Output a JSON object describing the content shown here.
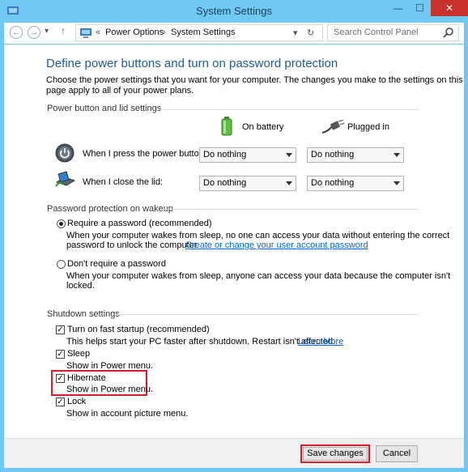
{
  "window": {
    "title": "System Settings",
    "minimize": "—",
    "maximize": "☐",
    "close": "✕"
  },
  "nav": {
    "back": "←",
    "forward": "→",
    "dropdown": "▾",
    "up": "↑",
    "refresh": "↻",
    "crumb_sep": "«",
    "breadcrumb": [
      "Power Options",
      "System Settings"
    ],
    "breadcrumb_arrow": "›",
    "address_dropdown": "▾",
    "search_placeholder": "Search Control Panel"
  },
  "main": {
    "heading": "Define power buttons and turn on password protection",
    "intro_line1": "Choose the power settings that you want for your computer. The changes you make to the settings on this",
    "intro_line2": "page apply to all of your power plans.",
    "power_section_title": "Power button and lid settings",
    "col_on_battery": "On battery",
    "col_plugged_in": "Plugged in",
    "row_power_button": "When I press the power button:",
    "row_lid": "When I close the lid:",
    "power_button_battery": "Do nothing",
    "power_button_plugged": "Do nothing",
    "lid_battery": "Do nothing",
    "lid_plugged": "Do nothing",
    "password_section_title": "Password protection on wakeup",
    "require_password_label": "Require a password (recommended)",
    "require_password_desc1": "When your computer wakes from sleep, no one can access your data without entering the correct",
    "require_password_desc2": "password to unlock the computer.",
    "require_password_link": "Create or change your user account password",
    "no_password_label": "Don't require a password",
    "no_password_desc1": "When your computer wakes from sleep, anyone can access your data because the computer isn't",
    "no_password_desc2": "locked.",
    "shutdown_section_title": "Shutdown settings",
    "fast_startup_label": "Turn on fast startup (recommended)",
    "fast_startup_desc": "This helps start your PC faster after shutdown. Restart isn't affected.",
    "learn_more": "Learn More",
    "sleep_label": "Sleep",
    "sleep_desc": "Show in Power menu.",
    "hibernate_label": "Hibernate",
    "hibernate_desc": "Show in Power menu.",
    "lock_label": "Lock",
    "lock_desc": "Show in account picture menu.",
    "checkmark": "✓"
  },
  "footer": {
    "save": "Save changes",
    "cancel": "Cancel"
  },
  "colors": {
    "accent_blue": "#1e5a9a",
    "highlight_red": "#d81b2b",
    "titlebar": "#6fc9f2"
  },
  "icons": [
    "control-panel-icon",
    "power-button-icon",
    "laptop-lid-icon",
    "battery-icon",
    "plug-icon",
    "search-icon"
  ]
}
